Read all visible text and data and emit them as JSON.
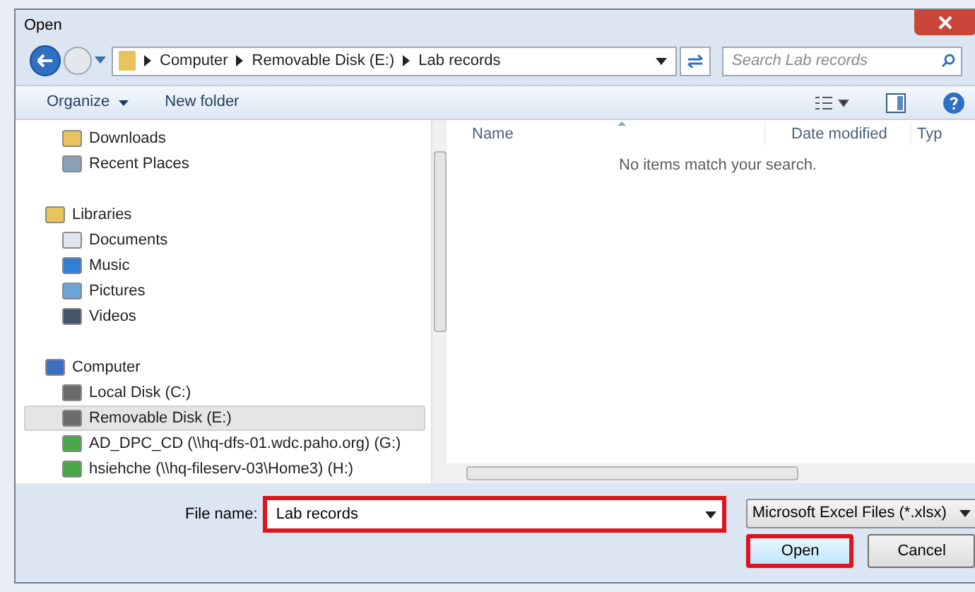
{
  "window": {
    "title": "Open"
  },
  "address": {
    "crumbs": [
      "Computer",
      "Removable Disk (E:)",
      "Lab records"
    ]
  },
  "search": {
    "placeholder": "Search Lab records"
  },
  "toolbar": {
    "organize": "Organize",
    "new_folder": "New folder"
  },
  "nav": [
    {
      "label": "Downloads",
      "selected": false
    },
    {
      "label": "Recent Places",
      "selected": false
    },
    {
      "label": "Libraries",
      "selected": false,
      "children": [
        {
          "label": "Documents",
          "selected": false
        },
        {
          "label": "Music",
          "selected": false
        },
        {
          "label": "Pictures",
          "selected": false
        },
        {
          "label": "Videos",
          "selected": false
        }
      ]
    },
    {
      "label": "Computer",
      "selected": false,
      "children": [
        {
          "label": "Local Disk (C:)",
          "selected": false
        },
        {
          "label": "Removable Disk (E:)",
          "selected": true
        },
        {
          "label": "AD_DPC_CD (\\\\hq-dfs-01.wdc.paho.org) (G:)",
          "selected": false
        },
        {
          "label": "hsiehche (\\\\hq-fileserv-03\\Home3) (H:)",
          "selected": false
        }
      ]
    }
  ],
  "columns": [
    "Name",
    "Date modified",
    "Typ"
  ],
  "empty_message": "No items match your search.",
  "file_name": {
    "label": "File name:",
    "value": "Lab records",
    "highlighted": true
  },
  "file_type": "Microsoft Excel Files (*.xlsx)",
  "buttons": [
    {
      "label": "Open",
      "highlighted": true
    },
    {
      "label": "Cancel",
      "highlighted": false
    }
  ]
}
